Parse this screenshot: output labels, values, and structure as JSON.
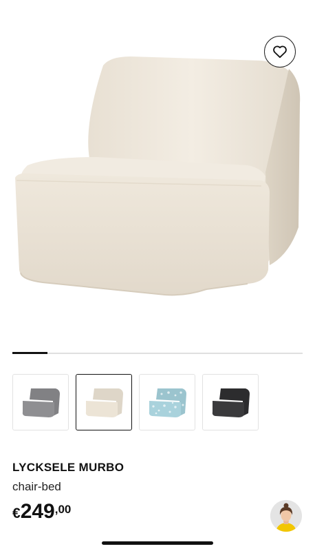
{
  "product": {
    "name": "LYCKSELE MURBO",
    "type": "chair-bed",
    "price": {
      "currency": "€",
      "integer": "249",
      "decimal": ",00"
    }
  },
  "gallery": {
    "progress": 0.12,
    "thumbnails": [
      {
        "color_name": "grey",
        "color": "#8f8f92",
        "selected": false
      },
      {
        "color_name": "natural",
        "color": "#ece4d6",
        "selected": true
      },
      {
        "color_name": "blue pattern",
        "color": "#a9d2dc",
        "selected": false
      },
      {
        "color_name": "dark grey",
        "color": "#3a3a3c",
        "selected": false
      }
    ]
  },
  "icons": {
    "favorite": "heart-icon",
    "assistant": "assistant-avatar"
  },
  "colors": {
    "accent": "#111111",
    "hero_chair": "#efe8dc"
  }
}
